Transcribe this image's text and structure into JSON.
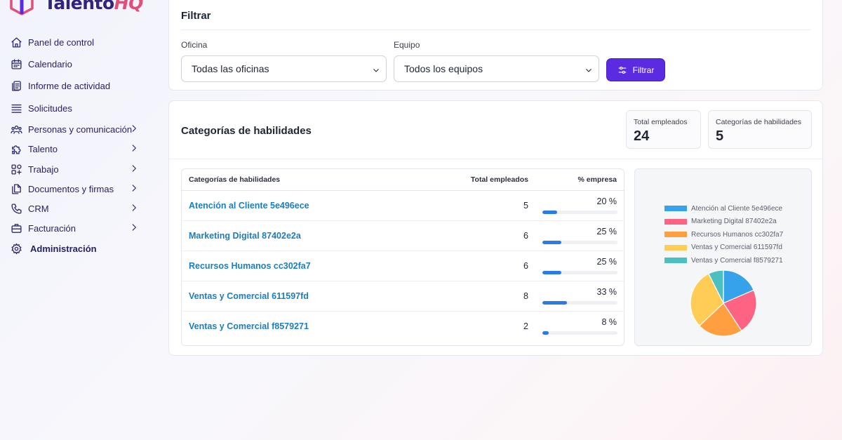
{
  "brand": {
    "name_main": "Talento",
    "name_accent": "HQ"
  },
  "sidebar": {
    "items": [
      {
        "label": "Panel de control",
        "icon": "home-icon",
        "has_children": false
      },
      {
        "label": "Calendario",
        "icon": "calendar-icon",
        "has_children": false
      },
      {
        "label": "Informe de actividad",
        "icon": "clipboard-icon",
        "has_children": false
      },
      {
        "label": "Solicitudes",
        "icon": "list-icon",
        "has_children": false
      },
      {
        "label": "Personas y comunicación",
        "icon": "people-icon",
        "has_children": true
      },
      {
        "label": "Talento",
        "icon": "puzzle-icon",
        "has_children": true
      },
      {
        "label": "Trabajo",
        "icon": "grid-icon",
        "has_children": true
      },
      {
        "label": "Documentos y firmas",
        "icon": "documents-icon",
        "has_children": true
      },
      {
        "label": "CRM",
        "icon": "phone-icon",
        "has_children": true
      },
      {
        "label": "Facturación",
        "icon": "briefcase-icon",
        "has_children": true
      },
      {
        "label": "Administración",
        "icon": "gear-icon",
        "has_children": false
      }
    ]
  },
  "filter": {
    "title": "Filtrar",
    "office_label": "Oficina",
    "office_value": "Todas las oficinas",
    "team_label": "Equipo",
    "team_value": "Todos los equipos",
    "button_label": "Filtrar"
  },
  "skills": {
    "title": "Categorías de habilidades",
    "stats": {
      "total_employees_label": "Total empleados",
      "total_employees_value": "24",
      "categories_label": "Categorías de habilidades",
      "categories_value": "5"
    },
    "table": {
      "headers": [
        "Categorías de habilidades",
        "Total empleados",
        "% empresa"
      ],
      "rows": [
        {
          "category": "Atención al Cliente 5e496ece",
          "count": "5",
          "percent_label": "20 %",
          "percent": 20
        },
        {
          "category": "Marketing Digital 87402e2a",
          "count": "6",
          "percent_label": "25 %",
          "percent": 25
        },
        {
          "category": "Recursos Humanos cc302fa7",
          "count": "6",
          "percent_label": "25 %",
          "percent": 25
        },
        {
          "category": "Ventas y Comercial 611597fd",
          "count": "8",
          "percent_label": "33 %",
          "percent": 33
        },
        {
          "category": "Ventas y Comercial f8579271",
          "count": "2",
          "percent_label": "8 %",
          "percent": 8
        }
      ]
    }
  },
  "chart_data": {
    "type": "pie",
    "labels": [
      "Atención al Cliente 5e496ece",
      "Marketing Digital 87402e2a",
      "Recursos Humanos cc302fa7",
      "Ventas y Comercial 611597fd",
      "Ventas y Comercial f8579271"
    ],
    "values": [
      5,
      6,
      6,
      8,
      2
    ],
    "colors": [
      "#36a2eb",
      "#ff6384",
      "#ff9f40",
      "#ffcd56",
      "#4bc0c0"
    ],
    "legend_position": "top"
  }
}
